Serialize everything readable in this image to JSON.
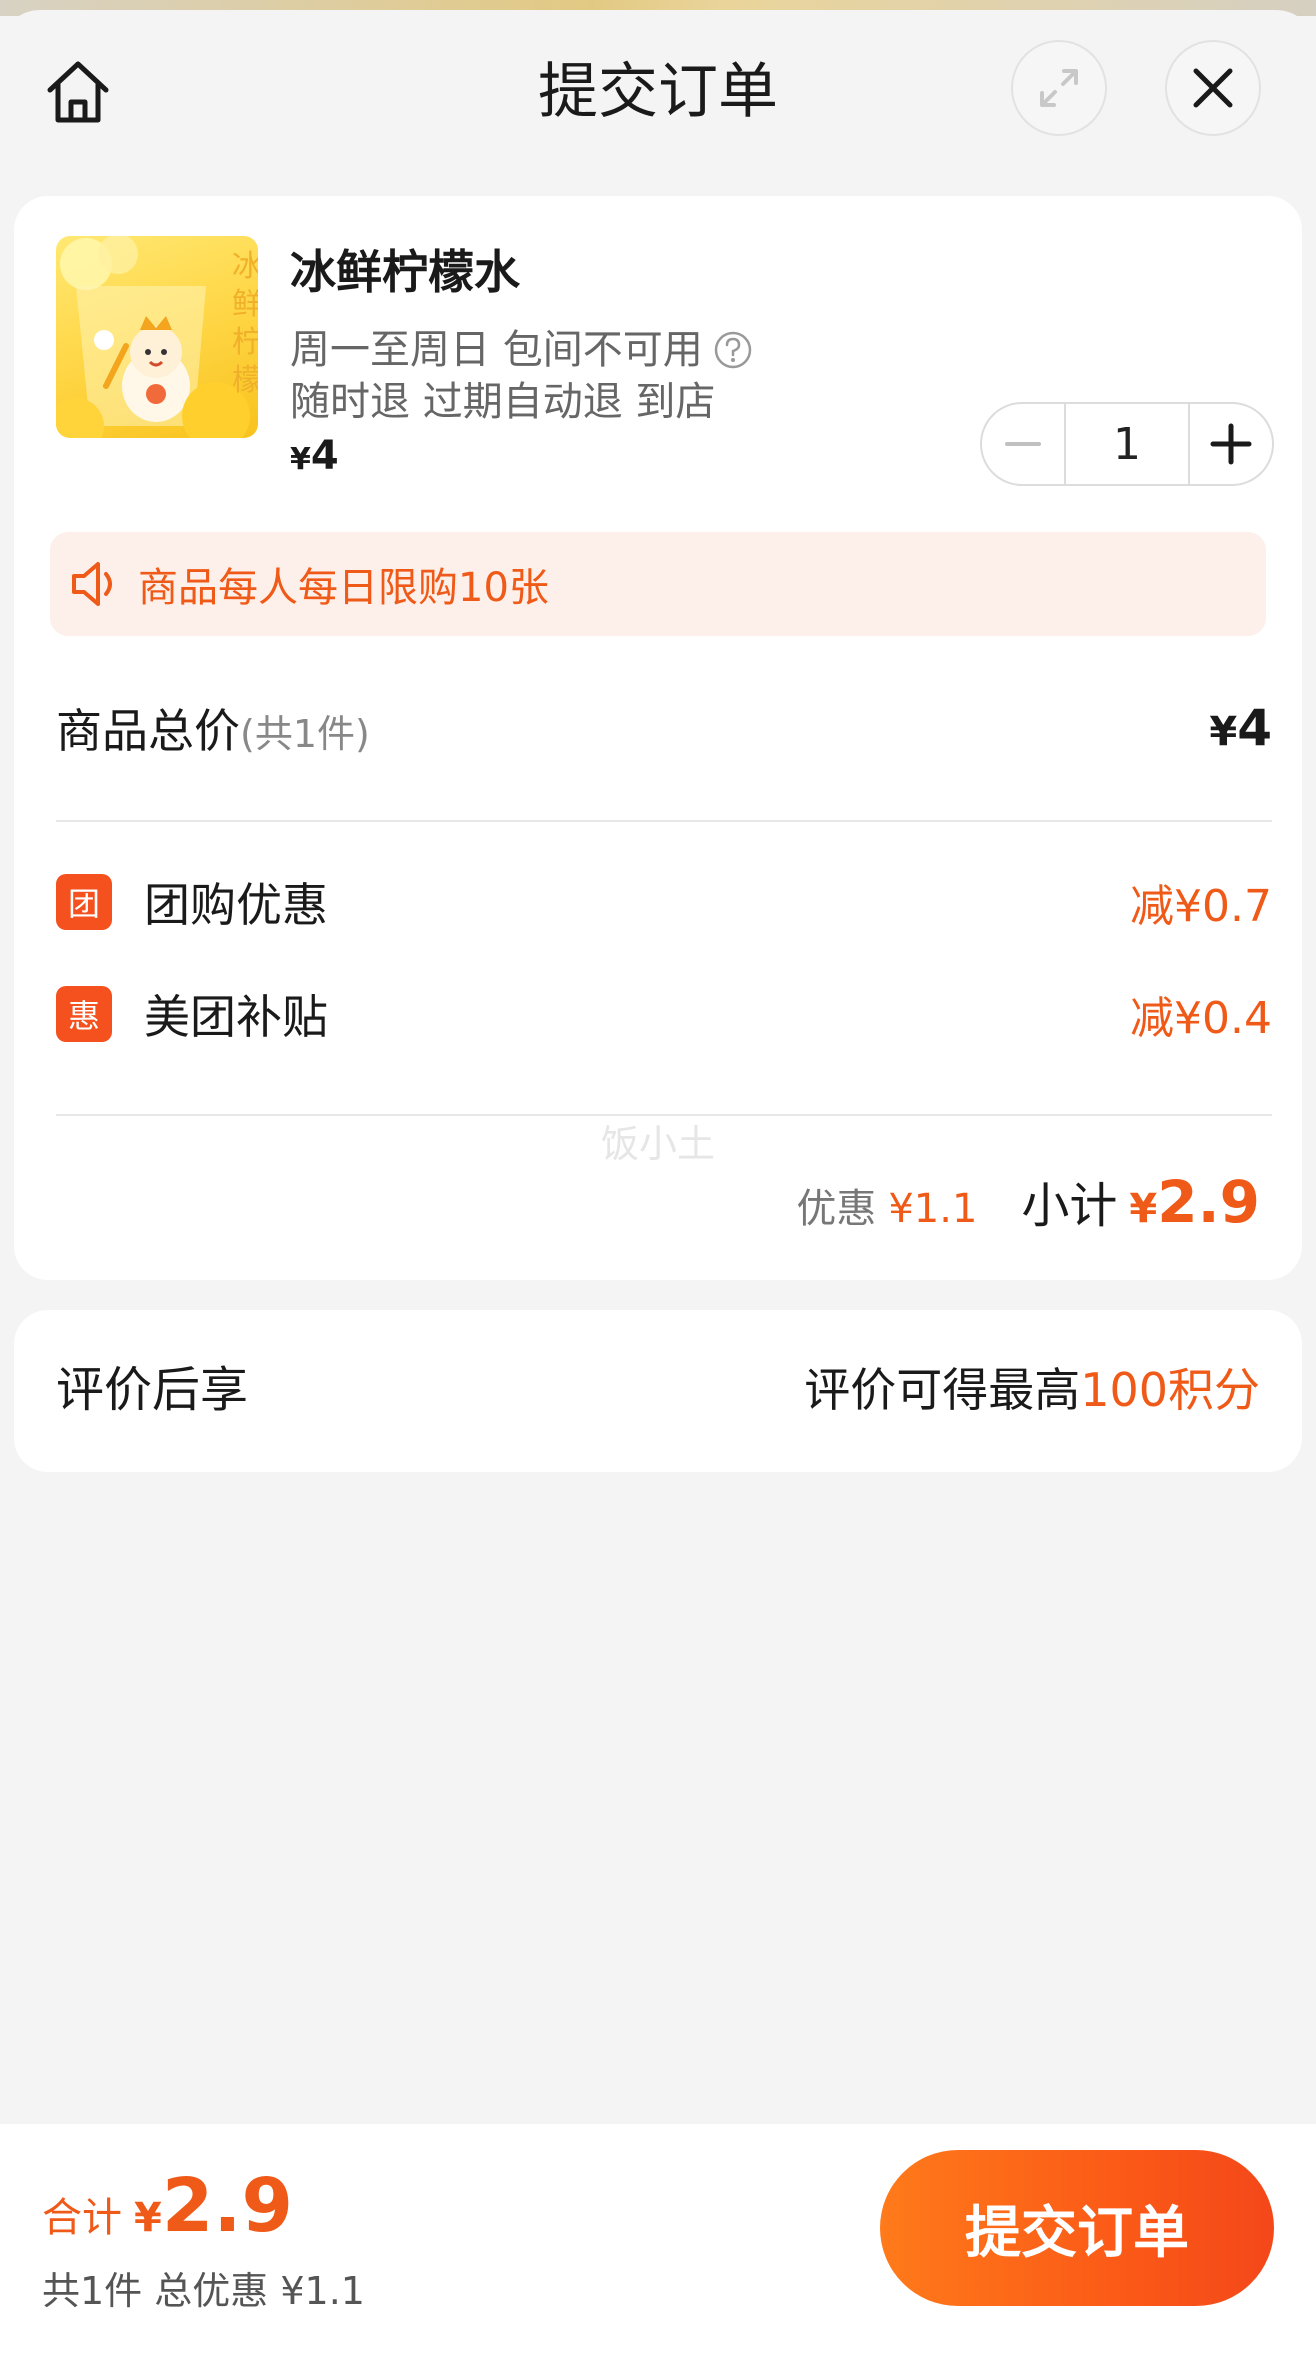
{
  "header": {
    "title": "提交订单"
  },
  "product": {
    "name": "冰鲜柠檬水",
    "availability": "周一至周日 包间不可用",
    "refund_policy": "随时退 过期自动退 到店",
    "price_yen": "¥",
    "price": "4",
    "quantity": "1",
    "image_text": "冰鲜柠檬"
  },
  "notice": {
    "text": "商品每人每日限购10张"
  },
  "total": {
    "label": "商品总价",
    "count": "(共1件)",
    "yen": "¥",
    "value": "4"
  },
  "discounts": [
    {
      "badge": "团",
      "label": "团购优惠",
      "value": "减¥0.7"
    },
    {
      "badge": "惠",
      "label": "美团补贴",
      "value": "减¥0.4"
    }
  ],
  "watermark": "饭小土",
  "subtotal": {
    "discount_label": "优惠",
    "discount_value": "¥1.1",
    "label": "小计",
    "yen": "¥",
    "value": "2.9"
  },
  "review": {
    "label": "评价后享",
    "right_text": "评价可得最高",
    "right_highlight": "100积分"
  },
  "bottom_bar": {
    "sum_label": "合计",
    "sum_yen": "¥",
    "sum_value": "2.9",
    "summary": "共1件 总优惠 ¥1.1",
    "submit_label": "提交订单"
  },
  "colors": {
    "accent": "#f05a18",
    "badge": "#f4511e",
    "notice_bg": "#fdefe9",
    "page_bg": "#f4f4f4"
  },
  "icons": [
    "home-icon",
    "expand-icon",
    "close-icon",
    "help-icon",
    "speaker-icon",
    "minus-icon",
    "plus-icon"
  ]
}
